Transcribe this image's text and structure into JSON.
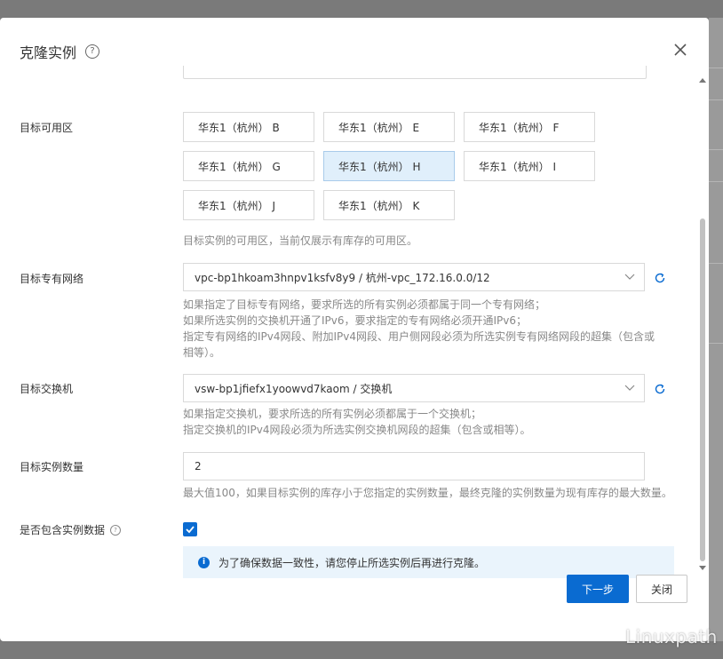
{
  "dialog": {
    "title": "克隆实例",
    "close_label": "关闭"
  },
  "zone": {
    "label": "目标可用区",
    "options": [
      "华东1（杭州） B",
      "华东1（杭州） E",
      "华东1（杭州） F",
      "华东1（杭州） G",
      "华东1（杭州） H",
      "华东1（杭州） I",
      "华东1（杭州） J",
      "华东1（杭州） K"
    ],
    "selected": "华东1（杭州） H",
    "hint": "目标实例的可用区，当前仅展示有库存的可用区。"
  },
  "vpc": {
    "label": "目标专有网络",
    "value": "vpc-bp1hkoam3hnpv1ksfv8y9 / 杭州-vpc_172.16.0.0/12",
    "hints": [
      "如果指定了目标专有网络，要求所选的所有实例必须都属于同一个专有网络；",
      "如果所选实例的交换机开通了IPv6，要求指定的专有网络必须开通IPv6；",
      "指定专有网络的IPv4网段、附加IPv4网段、用户侧网段必须为所选实例专有网络网段的超集（包含或相等）。"
    ]
  },
  "vswitch": {
    "label": "目标交换机",
    "value": "vsw-bp1jfiefx1yoowvd7kaom / 交换机",
    "hints": [
      "如果指定交换机，要求所选的所有实例必须都属于一个交换机；",
      "指定交换机的IPv4网段必须为所选实例交换机网段的超集（包含或相等）。"
    ]
  },
  "count": {
    "label": "目标实例数量",
    "value": "2",
    "hint": "最大值100，如果目标实例的库存小于您指定的实例数量，最终克隆的实例数量为现有库存的最大数量。"
  },
  "include_data": {
    "label": "是否包含实例数据",
    "checked": true,
    "notice": "为了确保数据一致性，请您停止所选实例后再进行克隆。"
  },
  "footer": {
    "next_label": "下一步",
    "close_label": "关闭"
  },
  "watermark": "Linuxpath",
  "colors": {
    "primary": "#0a6bd1",
    "selected_bg": "#e0effb",
    "notice_bg": "#eaf4fc"
  }
}
